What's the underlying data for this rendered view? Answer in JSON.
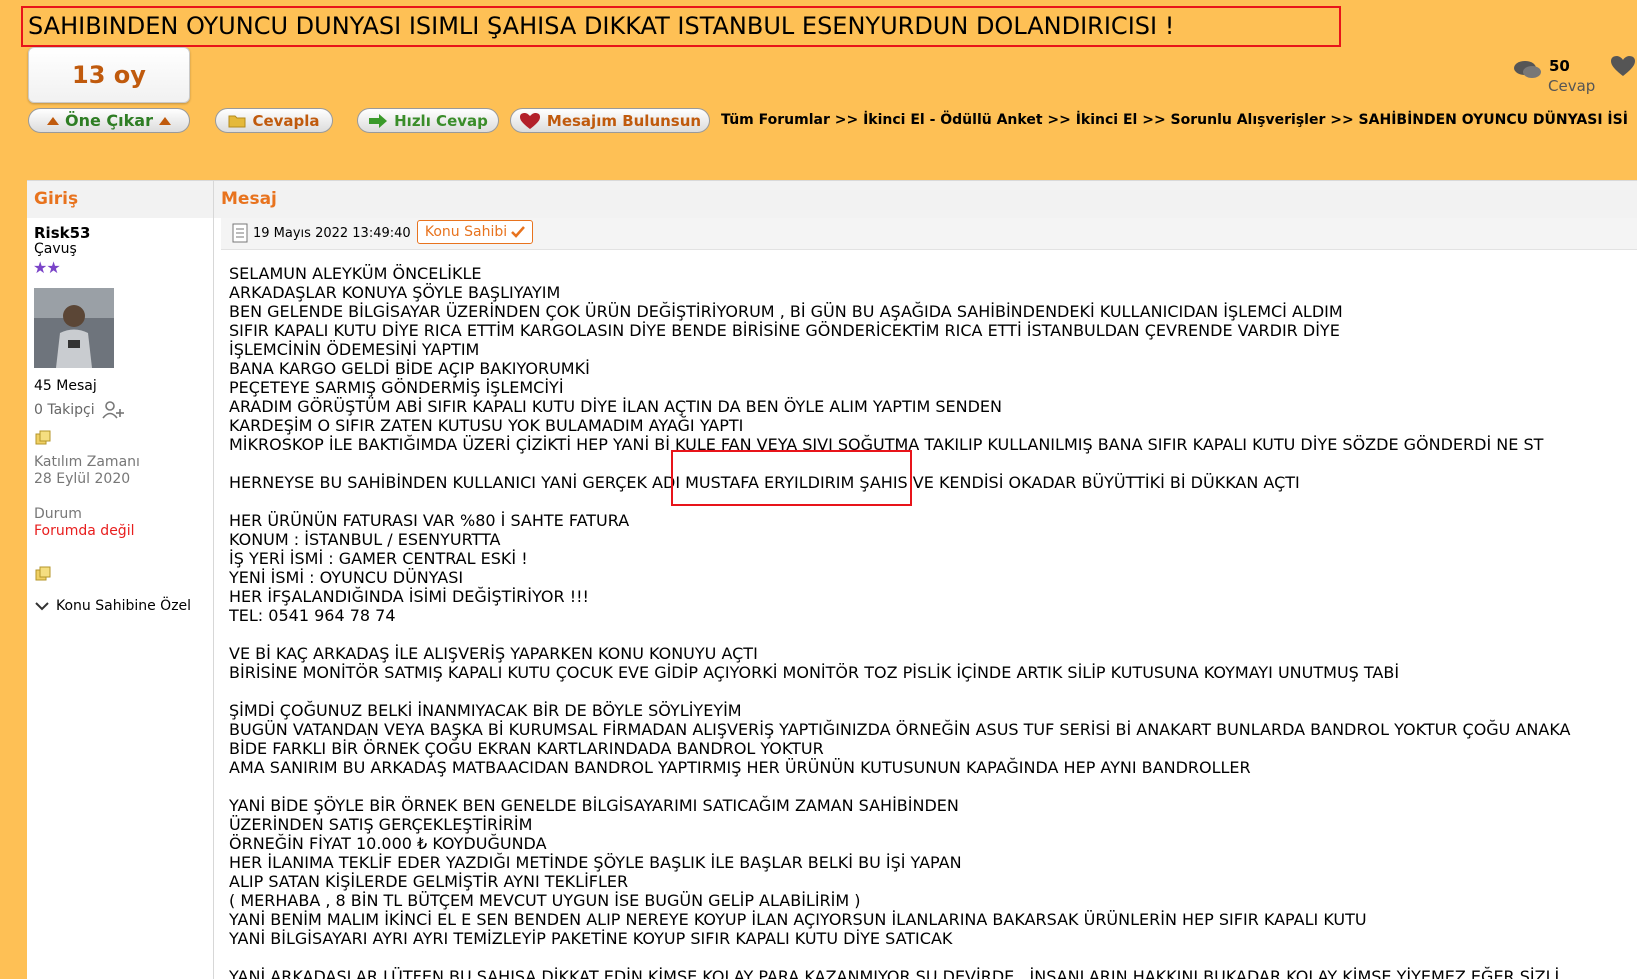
{
  "thread": {
    "title": "SAHIBINDEN OYUNCU DUNYASI ISIMLI ŞAHISA DIKKAT ISTANBUL ESENYURDUN DOLANDIRICISI !",
    "votes": "13 oy",
    "reply_count": "50",
    "reply_label": "Cevap"
  },
  "toolbar": {
    "one_cikar": "Öne Çıkar",
    "cevapla": "Cevapla",
    "hizli_cevap": "Hızlı Cevap",
    "mesajim": "Mesajım Bulunsun"
  },
  "breadcrumb": "Tüm Forumlar >> İkinci El - Ödüllü Anket >> İkinci El >> Sorunlu Alışverişler >> SAHİBİNDEN OYUNCU DÜNYASI İSİ",
  "table": {
    "col_left": "Giriş",
    "col_right": "Mesaj"
  },
  "user": {
    "name": "Risk53",
    "rank": "Çavuş",
    "messages": "45 Mesaj",
    "followers": "0 Takipçi",
    "join_label": "Katılım Zamanı",
    "join_date": "28 Eylül 2020",
    "status_label": "Durum",
    "status_value": "Forumda değil",
    "owner_toggle": "Konu Sahibine Özel"
  },
  "post": {
    "date": "19 Mayıs 2022 13:49:40",
    "badge": "Konu Sahibi",
    "body": "SELAMUN ALEYKÜM ÖNCELİKLE\nARKADAŞLAR KONUYA ŞÖYLE BAŞLIYAYIM\nBEN GELENDE BİLGİSAYAR ÜZERİNDEN ÇOK ÜRÜN DEĞİŞTİRİYORUM , Bİ GÜN BU AŞAĞIDA SAHİBİNDENDEKİ KULLANICIDAN İŞLEMCİ ALDIM\nSIFIR KAPALI KUTU DİYE RICA ETTİM KARGOLASIN DİYE BENDE BİRİSİNE GÖNDERİCEKTİM RICA ETTİ İSTANBULDAN ÇEVRENDE VARDIR DİYE\nİŞLEMCİNİN ÖDEMESİNİ YAPTIM\nBANA KARGO GELDİ BİDE AÇIP BAKIYORUMKİ\nPEÇETEYE SARMIŞ GÖNDERMİŞ İŞLEMCİYİ\nARADIM GÖRÜŞTÜM ABİ SIFIR KAPALI KUTU DİYE İLAN AÇTIN DA BEN ÖYLE ALIM YAPTIM SENDEN\nKARDEŞİM O SIFIR ZATEN KUTUSU YOK BULAMADIM AYAĞI YAPTI\nMİKROSKOP İLE BAKTIĞIMDA ÜZERİ ÇİZİKTİ HEP YANİ Bİ KULE FAN VEYA SIVI SOĞUTMA TAKILIP KULLANILMIŞ BANA SIFIR KAPALI KUTU DİYE SÖZDE GÖNDERDİ NE ST\n\nHERNEYSE BU SAHİBİNDEN KULLANICI YANİ GERÇEK ADI MUSTAFA ERYILDIRIM ŞAHIS VE KENDİSİ OKADAR BÜYÜTTİKİ Bİ DÜKKAN AÇTI\n\nHER ÜRÜNÜN FATURASI VAR %80 İ SAHTE FATURA\nKONUM : İSTANBUL / ESENYURTTA\nİŞ YERİ İSMİ : GAMER CENTRAL ESKİ !\nYENİ İSMİ : OYUNCU DÜNYASI\nHER İFŞALANDIĞINDA İSİMİ DEĞİŞTİRİYOR !!!\nTEL: 0541 964 78 74\n\nVE Bİ KAÇ ARKADAŞ İLE ALIŞVERİŞ YAPARKEN KONU KONUYU AÇTI\nBİRİSİNE MONİTÖR SATMIŞ KAPALI KUTU ÇOCUK EVE GİDİP AÇIYORKİ MONİTÖR TOZ PİSLİK İÇİNDE ARTIK SİLİP KUTUSUNA KOYMAYI UNUTMUŞ TABİ\n\nŞİMDİ ÇOĞUNUZ BELKİ İNANMIYACAK BİR DE BÖYLE SÖYLİYEYİM\nBUGÜN VATANDAN VEYA BAŞKA Bİ KURUMSAL FİRMADAN ALIŞVERİŞ YAPTIĞINIZDA ÖRNEĞİN ASUS TUF SERİSİ Bİ ANAKART BUNLARDA BANDROL YOKTUR ÇOĞU ANAKA\nBİDE FARKLI BİR ÖRNEK ÇOĞU EKRAN KARTLARINDADA BANDROL YOKTUR\nAMA SANIRIM BU ARKADAŞ MATBAACIDAN BANDROL YAPTIRMIŞ HER ÜRÜNÜN KUTUSUNUN KAPAĞINDA HEP AYNI BANDROLLER\n\nYANİ BİDE ŞÖYLE BİR ÖRNEK BEN GENELDE BİLGİSAYARIMI SATICAĞIM ZAMAN SAHİBİNDEN\nÜZERİNDEN SATIŞ GERÇEKLEŞTİRİRİM\nÖRNEĞİN FİYAT 10.000 ₺ KOYDUĞUNDA\nHER İLANIMA TEKLİF EDER YAZDIĞI METİNDE ŞÖYLE BAŞLIK İLE BAŞLAR BELKİ BU İŞİ YAPAN\nALIP SATAN KİŞİLERDE GELMİŞTİR AYNI TEKLİFLER\n( MERHABA , 8 BİN TL BÜTÇEM MEVCUT UYGUN İSE BUGÜN GELİP ALABİLİRİM )\nYANİ BENİM MALIM İKİNCİ EL E SEN BENDEN ALIP NEREYE KOYUP İLAN AÇIYORSUN İLANLARINA BAKARSAK ÜRÜNLERİN HEP SIFIR KAPALI KUTU\nYANİ BİLGİSAYARI AYRI AYRI TEMİZLEYİP PAKETİNE KOYUP SIFIR KAPALI KUTU DİYE SATICAK\n\nYANİ ARKADAŞLAR LÜTFEN BU ŞAHISA DİKKAT EDİN KİMSE KOLAY PARA KAZANMIYOR ŞU DEVİRDE   İNSANLARIN HAKKINI BUKADAR KOLAY KİMSE YİYEMEZ EĞER SİZLİ"
  },
  "colors": {
    "page_bg": "#fec055",
    "accent_orange": "#e8731e",
    "highlight_red": "#e8141a"
  }
}
